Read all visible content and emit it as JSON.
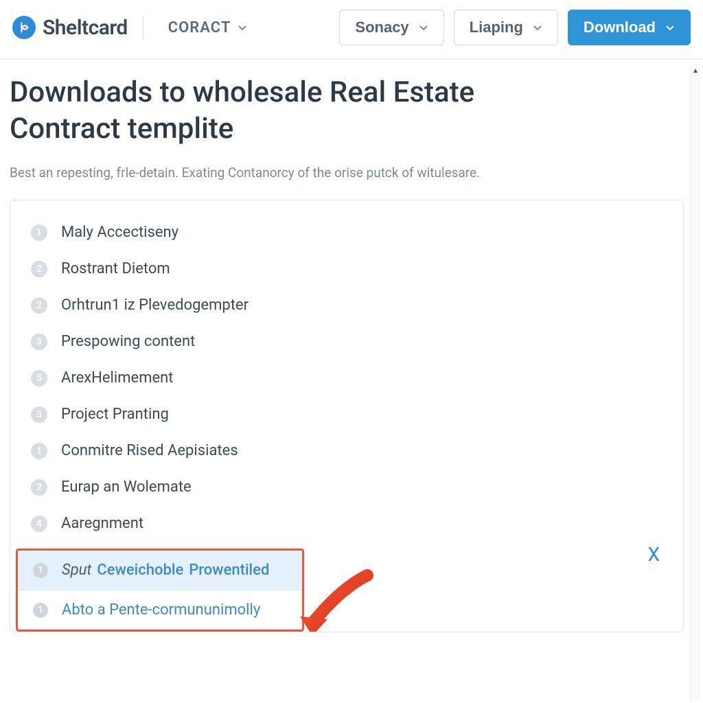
{
  "header": {
    "logo_text": "Sheltcard",
    "nav_coract": "CORACT",
    "btn_sonacy": "Sonacy",
    "btn_liaping": "Liaping",
    "btn_download": "Download"
  },
  "main": {
    "title": "Downloads to wholesale Real Estate Contract templite",
    "subtitle": "Best an repesting, frle-detain. Exating Contanorcy of the orise putck of witulesare.",
    "items": [
      {
        "num": "1",
        "label": "Maly Accectiseny"
      },
      {
        "num": "2",
        "label": "Rostrant Dietom"
      },
      {
        "num": "2",
        "label": "Orhtrun1 iz Plevedogempter"
      },
      {
        "num": "3",
        "label": "Prespowing content"
      },
      {
        "num": "5",
        "label": "ArexHelimement"
      },
      {
        "num": "3",
        "label": "Project Pranting"
      },
      {
        "num": "1",
        "label": "Conmitre Rised Aepisiates"
      },
      {
        "num": "2",
        "label": "Eurap an Wolemate"
      },
      {
        "num": "4",
        "label": "Aaregnment"
      }
    ],
    "highlight": {
      "top_badge": "1",
      "top_text1": "Sput",
      "top_text2": "Ceweichoble",
      "top_text3": "Prowentiled",
      "bot_badge": "1",
      "bot_text": "Abto a Pente-cormununimolly"
    },
    "close_label": "X"
  }
}
